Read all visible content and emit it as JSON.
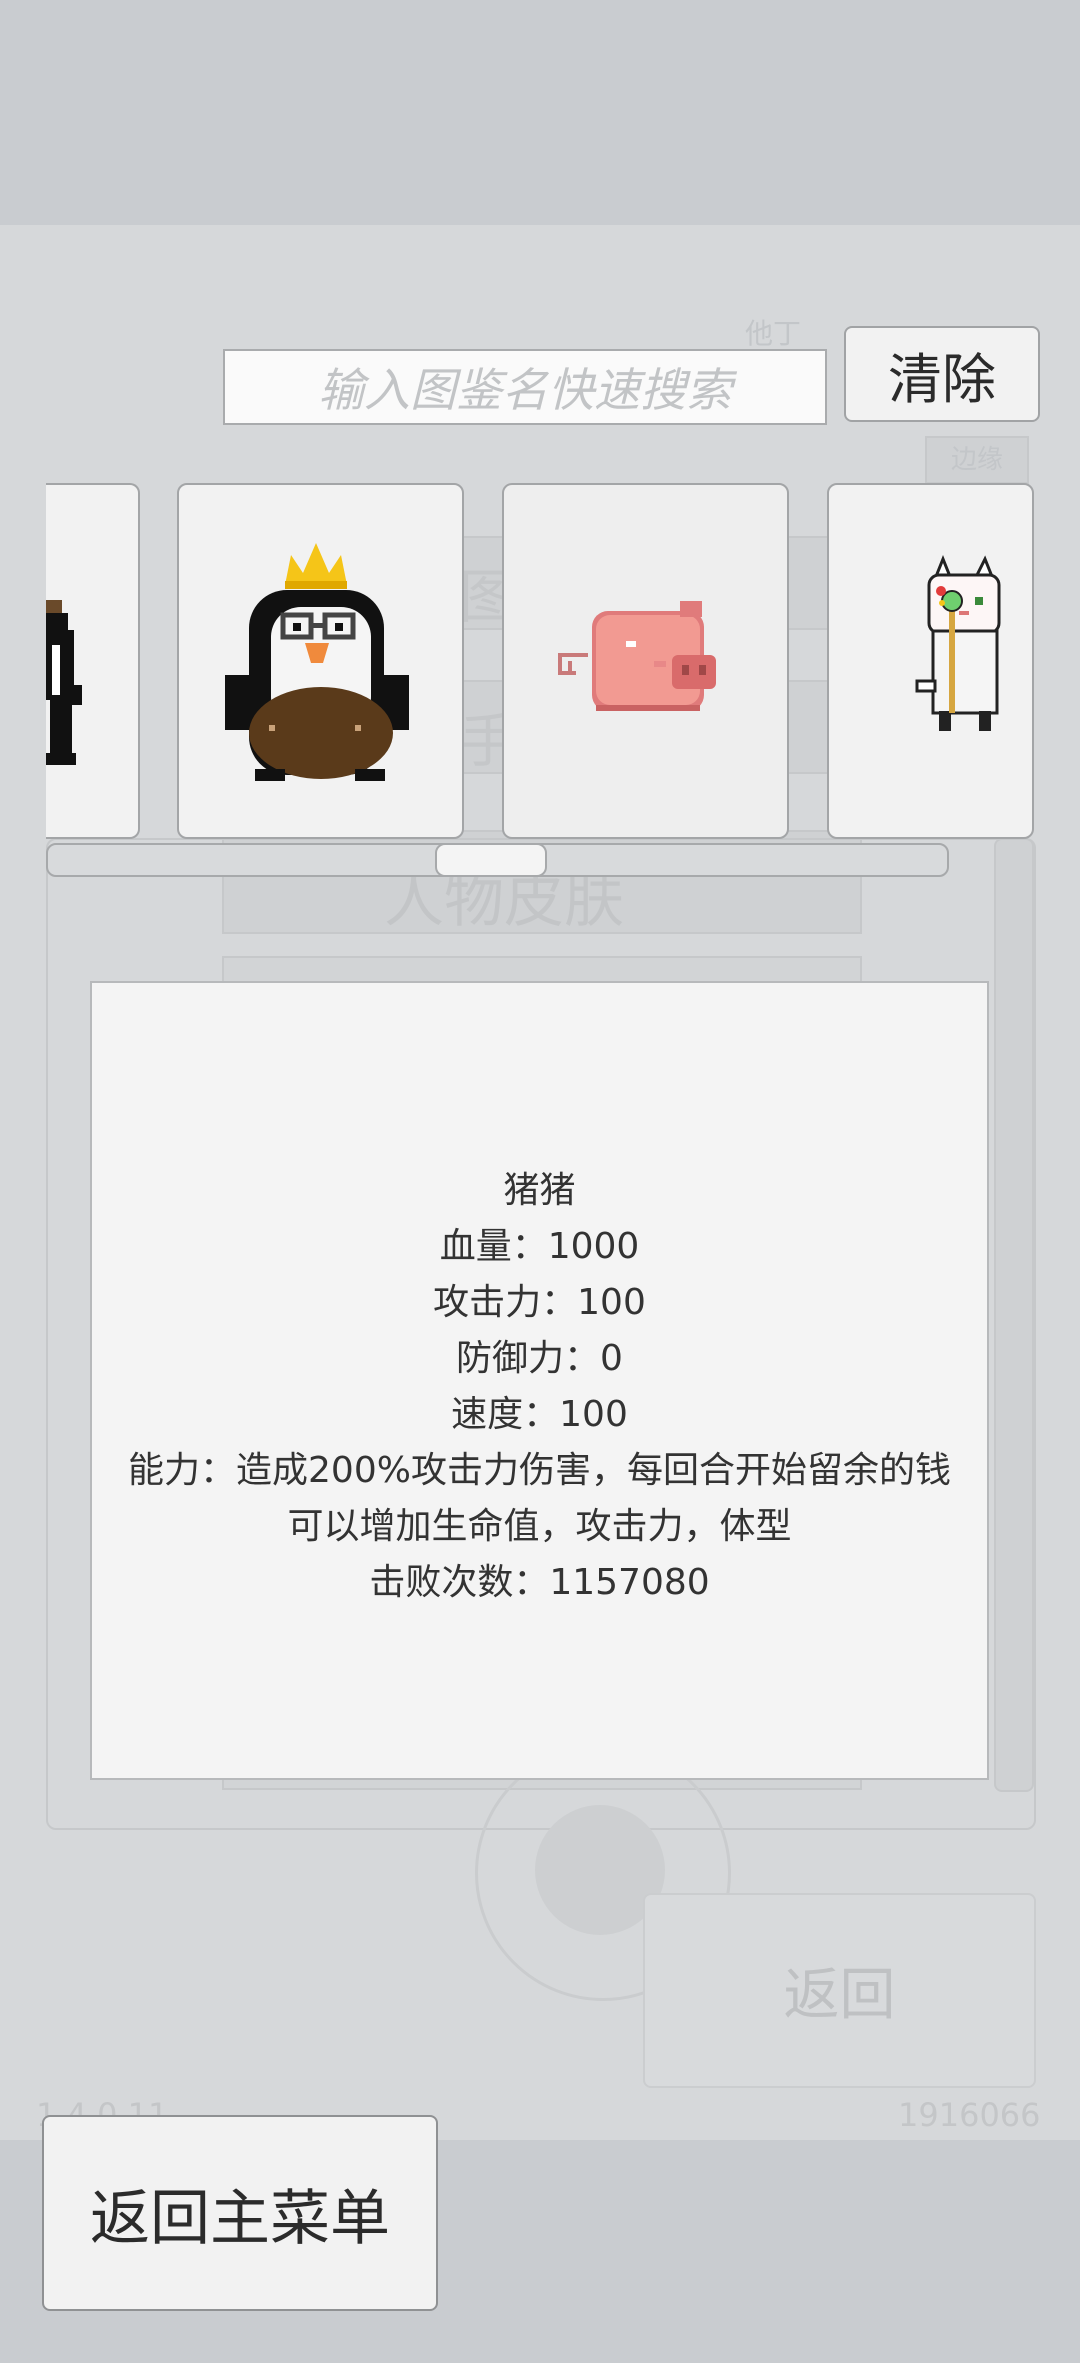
{
  "search": {
    "placeholder": "输入图鉴名快速搜索",
    "clear_label": "清除"
  },
  "background": {
    "partial_label_1": "他丁",
    "partial_label_2": "边缘",
    "heading_fragment": "图",
    "subheading_fragment": "手",
    "skin_label": "人物皮肤",
    "return_label": "返回",
    "version": "1.4.0.11",
    "user_id": "1916066"
  },
  "carousel": {
    "cards": [
      {
        "icon": "partial-character-icon"
      },
      {
        "icon": "penguin-king-icon"
      },
      {
        "icon": "pig-icon",
        "selected": true
      },
      {
        "icon": "cat-with-staff-icon"
      }
    ],
    "scroll_position": 0.4
  },
  "info": {
    "name": "猪猪",
    "hp": "血量：1000",
    "attack": "攻击力：100",
    "defense": "防御力：0",
    "speed": "速度：100",
    "ability_line1": "能力：造成200%攻击力伤害，每回合开始留余的钱",
    "ability_line2": "可以增加生命值，攻击力，体型",
    "defeats": "击败次数：1157080"
  },
  "main_menu_label": "返回主菜单"
}
